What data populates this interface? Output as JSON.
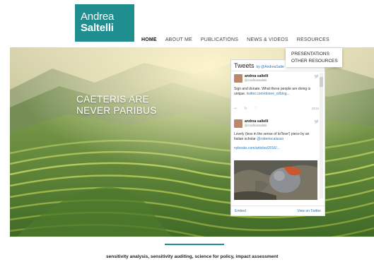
{
  "logo": {
    "first": "Andrea",
    "last": "Saltelli"
  },
  "nav": {
    "items": [
      {
        "label": "HOME",
        "active": true
      },
      {
        "label": "ABOUT ME",
        "active": false
      },
      {
        "label": "PUBLICATIONS",
        "active": false
      },
      {
        "label": "NEWS & VIDEOS",
        "active": false
      },
      {
        "label": "RESOURCES",
        "active": false
      }
    ]
  },
  "dropdown": {
    "items": [
      "PRESENTATIONS",
      "OTHER RESOURCES"
    ]
  },
  "hero": {
    "line1": "CAETERIS ARE",
    "line2": "NEVER PARIBUS"
  },
  "tweets": {
    "title": "Tweets",
    "by": "by @AndreaSalte",
    "items": [
      {
        "name": "andrea saltelli",
        "handle": "@AndreaSalteli",
        "text": "Sign and donate. What these people are doing is unique.",
        "link": "twitter.com/donee_nl/blog...",
        "date": "2016"
      },
      {
        "name": "andrea saltelli",
        "handle": "@AndreaSalteli",
        "text": "Lovely (less in the sense of lol'love') piece by an Italian scholar",
        "mention": "@robertocalasso",
        "link": "nybooks.com/articles/2016/..."
      }
    ],
    "footer": {
      "embed": "Embed",
      "view": "View on Twitter"
    }
  },
  "keywords": "sensitivity analysis, sensitivity auditing, science for policy, impact assessment",
  "colors": {
    "brand": "#1e8e8f",
    "twitter": "#2b7bb9"
  }
}
